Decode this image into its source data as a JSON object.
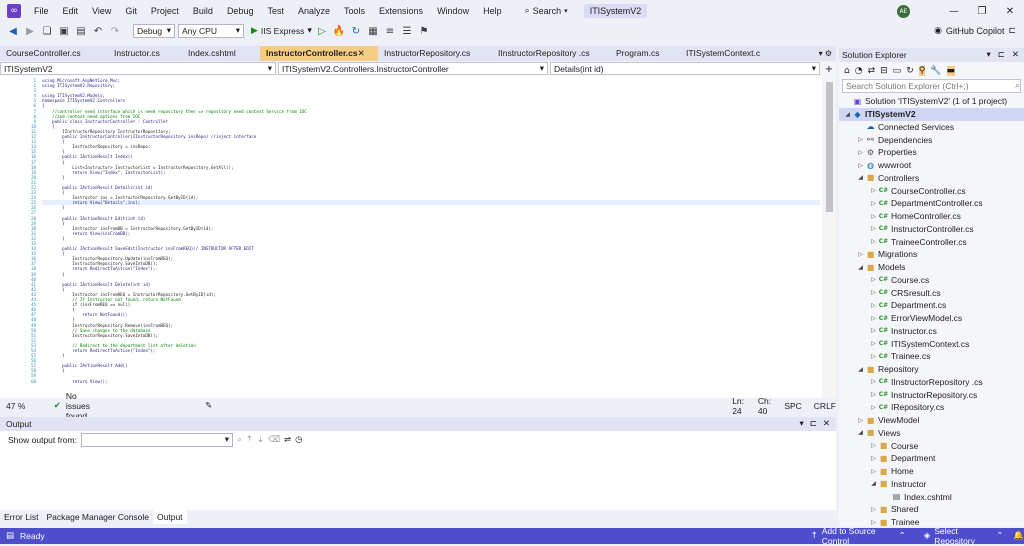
{
  "menu": [
    "File",
    "Edit",
    "View",
    "Git",
    "Project",
    "Build",
    "Debug",
    "Test",
    "Analyze",
    "Tools",
    "Extensions",
    "Window",
    "Help"
  ],
  "search_label": "Search",
  "solution_title": "ITISystemV2",
  "avatar_initials": "AE",
  "toolbar": {
    "config": "Debug",
    "platform": "Any CPU",
    "run_label": "IIS Express",
    "copilot": "GitHub Copilot"
  },
  "tabs": [
    {
      "label": "CourseController.cs"
    },
    {
      "label": "Instructor.cs"
    },
    {
      "label": "Index.cshtml"
    },
    {
      "label": "InstructorController.cs"
    },
    {
      "label": "InstructorRepository.cs"
    },
    {
      "label": "IInstructorRepository .cs"
    },
    {
      "label": "Program.cs"
    },
    {
      "label": "ITISystemContext.cs"
    }
  ],
  "nav": {
    "project": "ITISystemV2",
    "class": "ITISystemV2.Controllers.InstructorController",
    "member": "Details(int id)"
  },
  "code_lines": [
    "using Microsoft.AspNetCore.Mvc;",
    "using ITISystemV2.Repository;",
    "",
    "using ITISystemV2.Models;",
    "namespace ITISystemV2.Controllers",
    "{",
    "    //controller need interface which is need repository then => repository need context Service from IOC",
    "    //and context need options from IOC",
    "    public class InstructorController : Controller",
    "    {",
    "        IInstructorRepository InstructorRepository;",
    "        public InstructorController(IInstructorRepository insRepo) //inject interface",
    "        {",
    "            InstructorRepository = insRepo;",
    "        }",
    "        public IActionResult Index()",
    "        {",
    "            List<Instructor> InstructorList = InstructorRepository.GetAll();",
    "            return View(\"Index\", InstructorList);",
    "        }",
    "",
    "        public IActionResult Details(int id)",
    "        {",
    "            Instructor ins = InstructorRepository.GetByID(id);",
    "            return View(\"Details\",ins);",
    "        }",
    "",
    "        public IActionResult Edit(int id)",
    "        {",
    "            Instructor insFromDB = InstructorRepository.GetByID(id);",
    "            return View(insFromDB);",
    "        }",
    "",
    "        public IActionResult SaveEdit(Instructor insFromREQ)// INSTRUCTOR AFTER EDIT",
    "        {",
    "            InstructorRepository.Update(insFromREQ);",
    "            InstructorRepository.SaveIntoDB();",
    "            return RedirectToAction(\"Index\");",
    "        }",
    "",
    "        public IActionResult Delete(int id)",
    "        {",
    "            Instructor insFromREQ = InstructorRepository.GetByID(id);",
    "            // If Instructor not found, return NotFound",
    "            if (insFromREQ == null)",
    "            {",
    "                return NotFound();",
    "            }",
    "            InstructorRepository.Remove(insFromREQ);",
    "            // Save changes to the database",
    "            InstructorRepository.SaveIntoDB();",
    "",
    "            // Redirect to the department list after deletion",
    "            return RedirectToAction(\"Index\");",
    "        }",
    "",
    "        public IActionResult Add()",
    "        {",
    "",
    "            return View();"
  ],
  "line_numbers": [
    "1",
    "2",
    "3",
    "4",
    "5",
    "6",
    "7",
    "8",
    "9",
    "10",
    "11",
    "12",
    "13",
    "14",
    "15",
    "16",
    "17",
    "18",
    "19",
    "20",
    "21",
    "22",
    "23",
    "24",
    "25",
    "26",
    "27",
    "28",
    "29",
    "30",
    "31",
    "32",
    "33",
    "34",
    "35",
    "36",
    "37",
    "38",
    "39",
    "40",
    "41",
    "42",
    "43",
    "44",
    "45",
    "46",
    "47",
    "48",
    "49",
    "50",
    "51",
    "52",
    "53",
    "54",
    "55",
    "56",
    "57",
    "58",
    "59",
    "60"
  ],
  "editor_status": {
    "zoom": "47 %",
    "issues": "No issues found",
    "ln": "Ln: 24",
    "ch": "Ch: 40",
    "spc": "SPC",
    "crlf": "CRLF"
  },
  "output": {
    "title": "Output",
    "show_from": "Show output from:"
  },
  "bottom_tabs": [
    "Error List",
    "Package Manager Console",
    "Output"
  ],
  "solution_explorer": {
    "title": "Solution Explorer",
    "search_placeholder": "Search Solution Explorer (Ctrl+;)",
    "tree": [
      {
        "label": "Solution 'ITISystemV2' (1 of 1 project)",
        "depth": 0,
        "icon": "solution-icon",
        "arrow": "none"
      },
      {
        "label": "ITISystemV2",
        "depth": 0,
        "icon": "project-icon",
        "arrow": "open",
        "bold": true
      },
      {
        "label": "Connected Services",
        "depth": 1,
        "icon": "connected-services-icon",
        "arrow": "none"
      },
      {
        "label": "Dependencies",
        "depth": 1,
        "icon": "dependencies-icon",
        "arrow": "closed"
      },
      {
        "label": "Properties",
        "depth": 1,
        "icon": "properties-icon",
        "arrow": "closed"
      },
      {
        "label": "wwwroot",
        "depth": 1,
        "icon": "globe-icon",
        "arrow": "closed"
      },
      {
        "label": "Controllers",
        "depth": 1,
        "icon": "folder-icon",
        "arrow": "open"
      },
      {
        "label": "CourseController.cs",
        "depth": 2,
        "icon": "csharp-file-icon",
        "arrow": "closed"
      },
      {
        "label": "DepartmentController.cs",
        "depth": 2,
        "icon": "csharp-file-icon",
        "arrow": "closed"
      },
      {
        "label": "HomeController.cs",
        "depth": 2,
        "icon": "csharp-file-icon",
        "arrow": "closed"
      },
      {
        "label": "InstructorController.cs",
        "depth": 2,
        "icon": "csharp-file-icon",
        "arrow": "closed"
      },
      {
        "label": "TraineeController.cs",
        "depth": 2,
        "icon": "csharp-file-icon",
        "arrow": "closed"
      },
      {
        "label": "Migrations",
        "depth": 1,
        "icon": "folder-icon",
        "arrow": "closed"
      },
      {
        "label": "Models",
        "depth": 1,
        "icon": "folder-icon",
        "arrow": "open"
      },
      {
        "label": "Course.cs",
        "depth": 2,
        "icon": "csharp-file-icon",
        "arrow": "closed"
      },
      {
        "label": "CRSresult.cs",
        "depth": 2,
        "icon": "csharp-file-icon",
        "arrow": "closed"
      },
      {
        "label": "Department.cs",
        "depth": 2,
        "icon": "csharp-file-icon",
        "arrow": "closed"
      },
      {
        "label": "ErrorViewModel.cs",
        "depth": 2,
        "icon": "csharp-file-icon",
        "arrow": "closed"
      },
      {
        "label": "Instructor.cs",
        "depth": 2,
        "icon": "csharp-file-icon",
        "arrow": "closed"
      },
      {
        "label": "ITISystemContext.cs",
        "depth": 2,
        "icon": "csharp-file-icon",
        "arrow": "closed"
      },
      {
        "label": "Trainee.cs",
        "depth": 2,
        "icon": "csharp-file-icon",
        "arrow": "closed"
      },
      {
        "label": "Repository",
        "depth": 1,
        "icon": "folder-icon",
        "arrow": "open"
      },
      {
        "label": "IInstructorRepository .cs",
        "depth": 2,
        "icon": "csharp-file-icon",
        "arrow": "closed"
      },
      {
        "label": "InstructorRepository.cs",
        "depth": 2,
        "icon": "csharp-file-icon",
        "arrow": "closed"
      },
      {
        "label": "IRepository.cs",
        "depth": 2,
        "icon": "csharp-file-icon",
        "arrow": "closed"
      },
      {
        "label": "ViewModel",
        "depth": 1,
        "icon": "folder-icon",
        "arrow": "closed"
      },
      {
        "label": "Views",
        "depth": 1,
        "icon": "folder-icon",
        "arrow": "open"
      },
      {
        "label": "Course",
        "depth": 2,
        "icon": "folder-icon",
        "arrow": "closed"
      },
      {
        "label": "Department",
        "depth": 2,
        "icon": "folder-icon",
        "arrow": "closed"
      },
      {
        "label": "Home",
        "depth": 2,
        "icon": "folder-icon",
        "arrow": "closed"
      },
      {
        "label": "Instructor",
        "depth": 2,
        "icon": "folder-icon",
        "arrow": "open"
      },
      {
        "label": "Index.cshtml",
        "depth": 3,
        "icon": "cshtml-file-icon",
        "arrow": "none"
      },
      {
        "label": "Shared",
        "depth": 2,
        "icon": "folder-icon",
        "arrow": "closed"
      },
      {
        "label": "Trainee",
        "depth": 2,
        "icon": "folder-icon",
        "arrow": "closed"
      }
    ]
  },
  "statusbar": {
    "ready": "Ready",
    "source_control": "Add to Source Control",
    "repository": "Select Repository"
  },
  "colors": {
    "accent": "#4e4ecc",
    "active_tab": "#f5cc84",
    "titlebar": "#eef0f8"
  }
}
